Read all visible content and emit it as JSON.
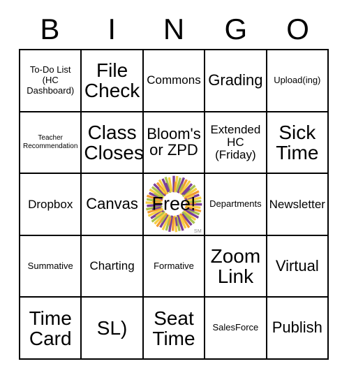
{
  "header": {
    "letters": [
      "B",
      "I",
      "N",
      "G",
      "O"
    ]
  },
  "grid": {
    "rows": [
      [
        {
          "text": "To-Do List (HC Dashboard)",
          "size": "sm"
        },
        {
          "text": "File Check",
          "size": "xl"
        },
        {
          "text": "Commons",
          "size": "md"
        },
        {
          "text": "Grading",
          "size": "lg"
        },
        {
          "text": "Upload(ing)",
          "size": "sm"
        }
      ],
      [
        {
          "text": "Teacher Recommendation",
          "size": "xs"
        },
        {
          "text": "Class Closes",
          "size": "xl"
        },
        {
          "text": "Bloom's or ZPD",
          "size": "lg"
        },
        {
          "text": "Extended HC (Friday)",
          "size": "md"
        },
        {
          "text": "Sick Time",
          "size": "xl"
        }
      ],
      [
        {
          "text": "Dropbox",
          "size": "md"
        },
        {
          "text": "Canvas",
          "size": "lg"
        },
        {
          "text": "Free!",
          "size": "free"
        },
        {
          "text": "Departments",
          "size": "sm"
        },
        {
          "text": "Newsletter",
          "size": "md"
        }
      ],
      [
        {
          "text": "Summative",
          "size": "sm"
        },
        {
          "text": "Charting",
          "size": "md"
        },
        {
          "text": "Formative",
          "size": "sm"
        },
        {
          "text": "Zoom Link",
          "size": "xl"
        },
        {
          "text": "Virtual",
          "size": "lg"
        }
      ],
      [
        {
          "text": "Time Card",
          "size": "xl"
        },
        {
          "text": "SL)",
          "size": "xl"
        },
        {
          "text": "Seat Time",
          "size": "xl"
        },
        {
          "text": "SalesForce",
          "size": "sm"
        },
        {
          "text": "Publish",
          "size": "lg"
        }
      ]
    ]
  },
  "free_space": {
    "label": "Free!",
    "service_mark": "SM",
    "logo_colors": {
      "purple": "#7B3F98",
      "orange": "#F29B30",
      "yellow": "#F7CF45",
      "green": "#A9C24D",
      "center": "#FFFFFF"
    }
  },
  "colors": {
    "border": "#000000",
    "background": "#FFFFFF",
    "text": "#000000",
    "service_mark": "#8A8A8A"
  }
}
